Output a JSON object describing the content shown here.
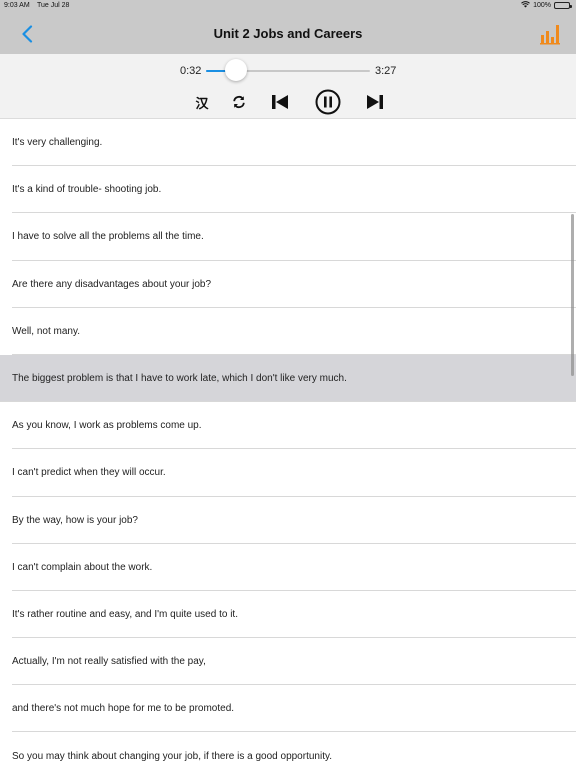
{
  "status_bar": {
    "time": "9:03 AM",
    "date": "Tue Jul 28",
    "battery_text": "100%",
    "battery_level": 1.0
  },
  "nav": {
    "title": "Unit 2 Jobs and Careers",
    "back_icon": "chevron-left-icon",
    "chart_icon": "bar-chart-icon",
    "accent_color": "#1a8fe3",
    "chart_color": "#f08a1c"
  },
  "player": {
    "current_time": "0:32",
    "total_time": "3:27",
    "progress_fraction": 0.18,
    "chinese_toggle_label": "汉",
    "controls": [
      "chinese-toggle",
      "repeat-icon",
      "previous-icon",
      "pause-icon",
      "next-icon"
    ]
  },
  "sentences": [
    "It's very challenging.",
    "It's a kind of trouble- shooting job.",
    "I have to solve all the problems all the time.",
    "Are there any disadvantages about your job?",
    "Well, not many.",
    "The biggest problem is that I have to work late, which I don't like very much.",
    "As you know, I work as problems come up.",
    "I can't predict when they will occur.",
    "By the way, how is your job?",
    "I can't complain about the work.",
    "It's rather routine and easy, and I'm quite used to it.",
    "Actually, I'm not really satisfied with the pay,",
    "and there's not much hope for me to be promoted.",
    "So you may think about changing your job, if there is a good opportunity."
  ],
  "active_index": 5
}
